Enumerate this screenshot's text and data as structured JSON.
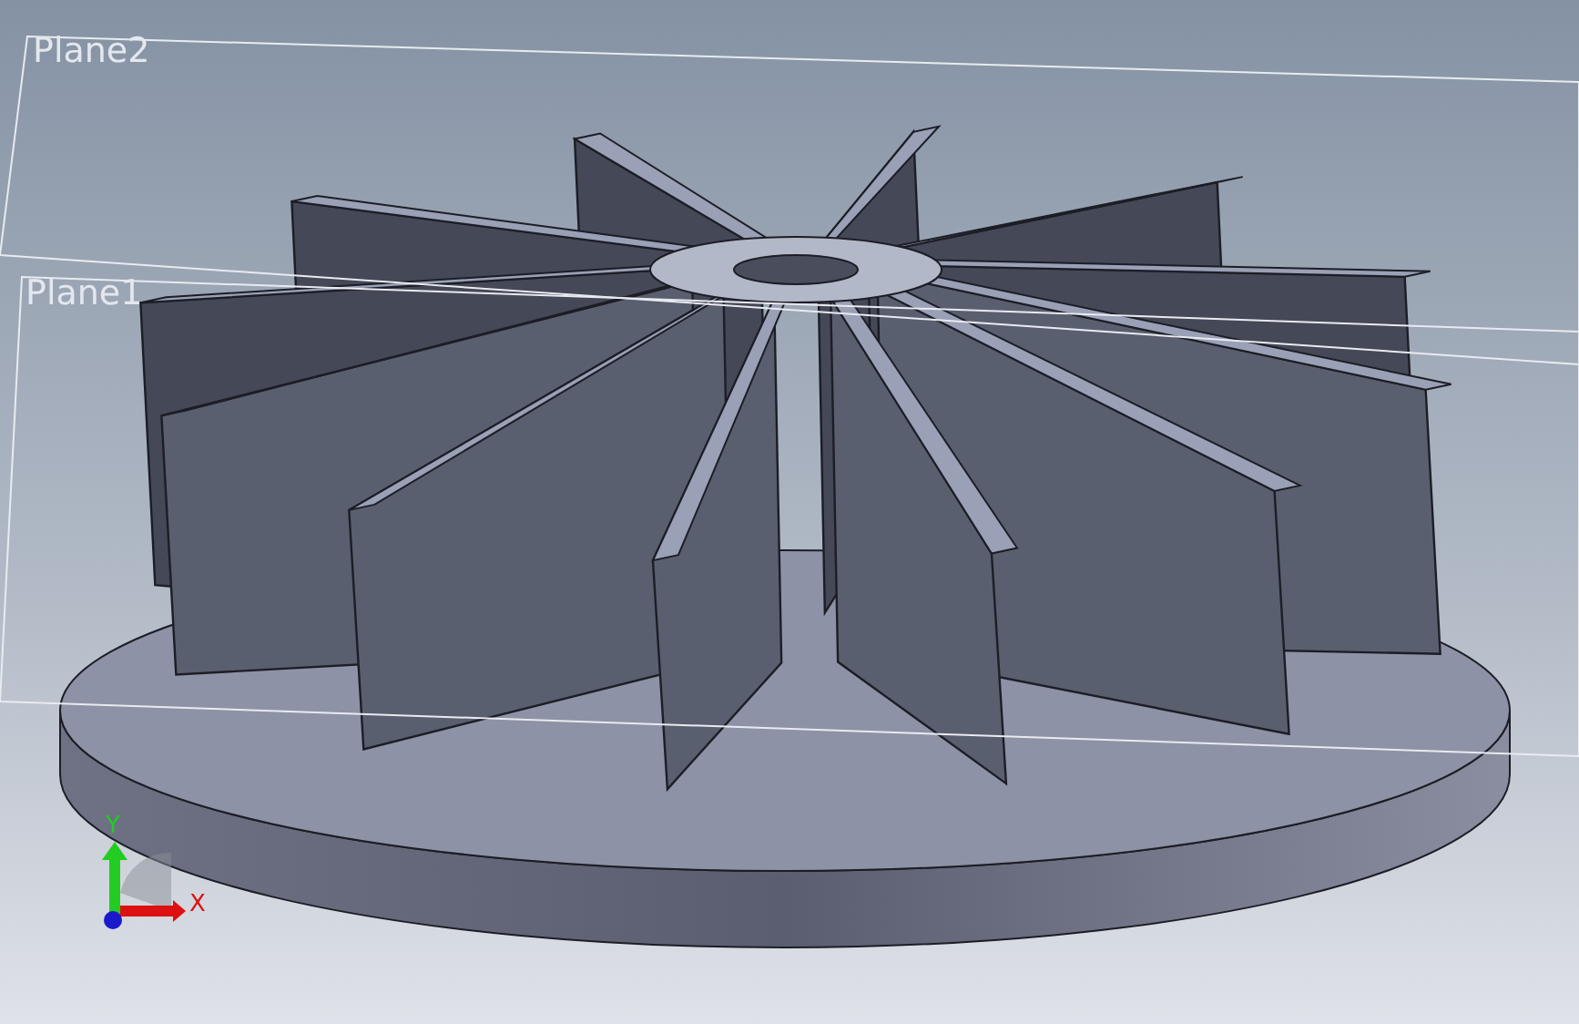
{
  "viewport": {
    "planes": [
      {
        "label": "Plane2"
      },
      {
        "label": "Plane1"
      }
    ],
    "triad": {
      "axes": [
        {
          "label": "Y",
          "color": "#22cc22"
        },
        {
          "label": "X",
          "color": "#dd1111"
        }
      ]
    }
  }
}
